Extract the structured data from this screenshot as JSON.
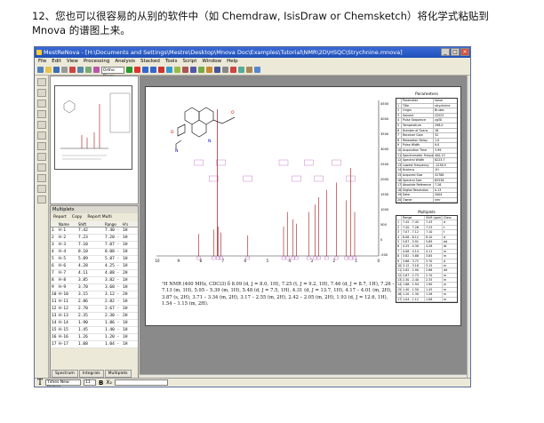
{
  "caption": "12、您也可以很容易的从别的软件中（如 Chemdraw, IsisDraw or Chemsketch）将化学式粘贴到 Mnova 的谱图上来。",
  "window": {
    "title": "MestReNova - [H:\\Documents and Settings\\Mestre\\Desktop\\Mnova Doc\\Examples\\Tutorial\\NMR\\2D\\HSQC\\Strychnine.mnova]",
    "controls": [
      "_",
      "□",
      "×"
    ]
  },
  "menu": [
    "File",
    "Edit",
    "View",
    "Processing",
    "Analysis",
    "Stacked",
    "Tools",
    "Script",
    "Window",
    "Help"
  ],
  "toolbar": {
    "zoom_select": "Ortho Rings"
  },
  "table_pane": {
    "title": "Multiplets",
    "toolbar": [
      "Report",
      "Copy",
      "Report Multi"
    ],
    "headers": [
      "",
      "Name",
      "Shift",
      "Range",
      "H's"
    ],
    "rows": [
      [
        "1",
        "H-1",
        "7.42",
        "7.40 - 7.45",
        "1H"
      ],
      [
        "2",
        "H-2",
        "7.23",
        "7.20 - 7.26",
        "1H"
      ],
      [
        "3",
        "H-3",
        "7.10",
        "7.07 - 7.12",
        "1H"
      ],
      [
        "4",
        "H-4",
        "8.10",
        "8.08 - 8.12",
        "1H"
      ],
      [
        "5",
        "H-5",
        "5.89",
        "5.87 - 5.91",
        "1H"
      ],
      [
        "6",
        "H-6",
        "4.28",
        "4.25 - 4.30",
        "1H"
      ],
      [
        "7",
        "H-7",
        "4.11",
        "4.08 - 4.14",
        "2H"
      ],
      [
        "8",
        "H-8",
        "3.85",
        "3.82 - 3.88",
        "1H"
      ],
      [
        "9",
        "H-9",
        "3.70",
        "3.68 - 3.72",
        "1H"
      ],
      [
        "10",
        "H-10",
        "3.15",
        "3.12 - 3.18",
        "2H"
      ],
      [
        "11",
        "H-11",
        "2.86",
        "2.82 - 2.90",
        "1H"
      ],
      [
        "12",
        "H-12",
        "2.70",
        "2.67 - 2.73",
        "1H"
      ],
      [
        "13",
        "H-13",
        "2.35",
        "2.30 - 2.40",
        "2H"
      ],
      [
        "14",
        "H-14",
        "1.90",
        "1.86 - 1.94",
        "1H"
      ],
      [
        "15",
        "H-15",
        "1.45",
        "1.40 - 1.50",
        "1H"
      ],
      [
        "16",
        "H-16",
        "1.26",
        "1.20 - 1.30",
        "1H"
      ],
      [
        "17",
        "H-17",
        "1.08",
        "1.04 - 1.12",
        "1H"
      ]
    ],
    "tabs": [
      "Spectrum",
      "Integrals",
      "Multiplets"
    ]
  },
  "parameters": {
    "title": "Parameters",
    "rows": [
      [
        "",
        "Parameter",
        "Value"
      ],
      [
        "1",
        "Title",
        "strychnine"
      ],
      [
        "2",
        "Origin",
        "Bruker"
      ],
      [
        "3",
        "Solvent",
        "CDCl3"
      ],
      [
        "4",
        "Pulse Sequence",
        "zg30"
      ],
      [
        "5",
        "Temperature",
        "298.0"
      ],
      [
        "6",
        "Number of Scans",
        "16"
      ],
      [
        "7",
        "Receiver Gain",
        "32"
      ],
      [
        "8",
        "Relaxation Delay",
        "1.0"
      ],
      [
        "9",
        "Pulse Width",
        "9.0"
      ],
      [
        "10",
        "Acquisition Time",
        "3.99"
      ],
      [
        "11",
        "Spectrometer Frequency",
        "400.13"
      ],
      [
        "12",
        "Spectral Width",
        "8223.7"
      ],
      [
        "13",
        "Lowest Frequency",
        "-1236.9"
      ],
      [
        "14",
        "Nucleus",
        "1H"
      ],
      [
        "15",
        "Acquired Size",
        "32768"
      ],
      [
        "16",
        "Spectral Size",
        "65536"
      ],
      [
        "17",
        "Absolute Reference",
        "7.26"
      ],
      [
        "18",
        "Digital Resolution",
        "0.13"
      ],
      [
        "19",
        "Date",
        "2004"
      ],
      [
        "20",
        "Owner",
        "nmr"
      ]
    ]
  },
  "multiplets_table": {
    "title": "Multiplets",
    "rows": [
      [
        "",
        "Range",
        "Shift (ppm)",
        "Class"
      ],
      [
        "1",
        "7.42 - 7.45",
        "7.43",
        "d"
      ],
      [
        "2",
        "7.20 - 7.26",
        "7.23",
        "t"
      ],
      [
        "3",
        "7.07 - 7.12",
        "7.10",
        "t"
      ],
      [
        "4",
        "8.08 - 8.12",
        "8.10",
        "d"
      ],
      [
        "5",
        "5.87 - 5.91",
        "5.89",
        "dd"
      ],
      [
        "6",
        "4.25 - 4.30",
        "4.28",
        "dt"
      ],
      [
        "7",
        "4.08 - 4.14",
        "4.11",
        "m"
      ],
      [
        "8",
        "3.82 - 3.88",
        "3.85",
        "m"
      ],
      [
        "9",
        "3.68 - 3.72",
        "3.70",
        "d"
      ],
      [
        "10",
        "3.12 - 3.18",
        "3.15",
        "m"
      ],
      [
        "11",
        "2.82 - 2.90",
        "2.86",
        "dd"
      ],
      [
        "12",
        "2.67 - 2.73",
        "2.70",
        "m"
      ],
      [
        "13",
        "2.30 - 2.40",
        "2.35",
        "m"
      ],
      [
        "14",
        "1.86 - 1.94",
        "1.90",
        "m"
      ],
      [
        "15",
        "1.40 - 1.50",
        "1.45",
        "m"
      ],
      [
        "16",
        "1.20 - 1.30",
        "1.26",
        "m"
      ],
      [
        "17",
        "1.04 - 1.12",
        "1.08",
        "m"
      ]
    ]
  },
  "report_text": "¹H NMR (400 MHz, CDCl3) δ 8.09 (d, J = 8.0, 1H), 7.25 (t, J = 9.2, 1H), 7.46 (d, J = 8.7, 1H), 7.26 – 7.13 (m, 1H), 5.95 – 5.39 (m, 1H), 5.48 (d, J = 7.5, 1H), 4.31 (d, J = 13.7, 1H), 4.17 – 4.01 (m, 2H), 3.87 (s, 2H), 3.71 – 3.34 (m, 2H), 3.17 – 2.55 (m, 2H), 2.42 – 2.05 (m, 2H), 1.93 (d, J = 12.6, 1H), 1.54 – 1.15 (m, 2H).",
  "axes": {
    "x_ticks": [
      "10",
      "9",
      "8",
      "7",
      "6",
      "5",
      "4",
      "3",
      "2",
      "1",
      "0"
    ],
    "y_ticks": [
      "4500",
      "4000",
      "3500",
      "3000",
      "2500",
      "2000",
      "1500",
      "1000",
      "500",
      "0",
      "-500"
    ]
  },
  "statusbar": {
    "font_select": "Times New Roman",
    "size_select": "11"
  },
  "colors": {
    "spectrum": "#a01010",
    "titlebar": "#2a5bc8",
    "integral": "#c060c0"
  }
}
